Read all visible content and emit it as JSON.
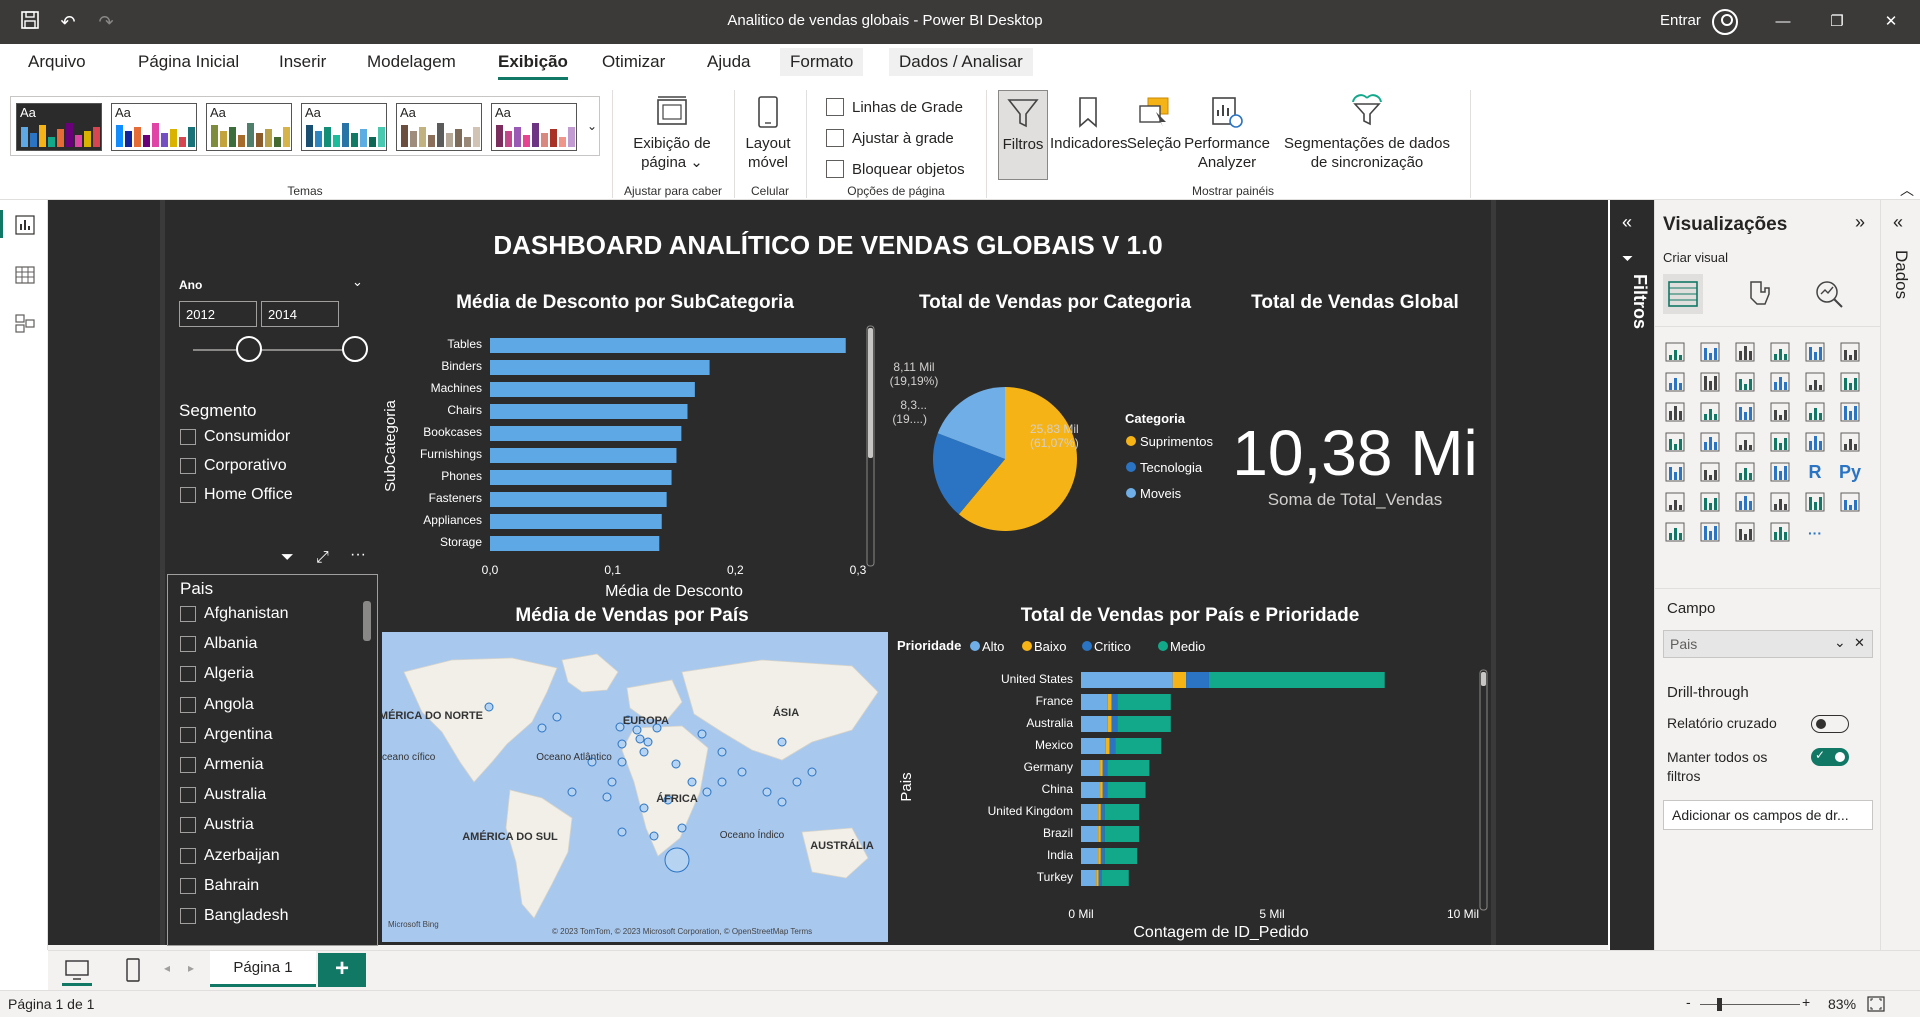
{
  "window": {
    "title": "Analitico de vendas globais - Power BI Desktop",
    "signin": "Entrar"
  },
  "tabs": [
    "Arquivo",
    "Página Inicial",
    "Inserir",
    "Modelagem",
    "Exibição",
    "Otimizar",
    "Ajuda",
    "Formato",
    "Dados / Analisar"
  ],
  "ribbon": {
    "group_temas": "Temas",
    "theme_aa": "Aa",
    "fit_label": "Exibição de página",
    "fit_group": "Ajustar para caber",
    "layout_label": "Layout móvel",
    "layout_group": "Celular",
    "check_grid": "Linhas de Grade",
    "check_snap": "Ajustar à grade",
    "check_lock": "Bloquear objetos",
    "options_group": "Opções de página",
    "btn_filters": "Filtros",
    "btn_bookmarks": "Indicadores",
    "btn_selection": "Seleção",
    "btn_perf": "Performance Analyzer",
    "btn_sync": "Segmentações de dados de sincronização",
    "panes_group": "Mostrar painéis"
  },
  "report": {
    "title": "DASHBOARD ANALÍTICO DE VENDAS GLOBAIS V 1.0",
    "year_slicer": {
      "label": "Ano",
      "from": "2012",
      "to": "2014"
    },
    "segment_slicer": {
      "label": "Segmento",
      "items": [
        "Consumidor",
        "Corporativo",
        "Home Office"
      ]
    },
    "country_slicer": {
      "label": "Pais",
      "items": [
        "Afghanistan",
        "Albania",
        "Algeria",
        "Angola",
        "Argentina",
        "Armenia",
        "Australia",
        "Austria",
        "Azerbaijan",
        "Bahrain",
        "Bangladesh"
      ]
    },
    "map": {
      "title": "Média de Vendas por País",
      "labels": [
        "AMÉRICA DO NORTE",
        "EUROPA",
        "ÁSIA",
        "Oceano Atlântico",
        "ÁFRICA",
        "AMÉRICA DO SUL",
        "Oceano Índico",
        "AUSTRÁLIA",
        "ceano cífico"
      ],
      "attribution": "© 2023 TomTom, © 2023 Microsoft Corporation, © OpenStreetMap  Terms",
      "brand": "Microsoft Bing"
    },
    "kpi": {
      "title": "Total de Vendas Global",
      "value": "10,38 Mi",
      "caption": "Soma de Total_Vendas"
    }
  },
  "chart_data": [
    {
      "type": "bar",
      "title": "Média de Desconto por SubCategoria",
      "xlabel": "Média de Desconto",
      "ylabel": "SubCategoria",
      "categories": [
        "Tables",
        "Binders",
        "Machines",
        "Chairs",
        "Bookcases",
        "Furnishings",
        "Phones",
        "Fasteners",
        "Appliances",
        "Storage"
      ],
      "values": [
        0.29,
        0.179,
        0.167,
        0.161,
        0.156,
        0.152,
        0.148,
        0.144,
        0.14,
        0.138
      ],
      "xticks": [
        "0,0",
        "0,1",
        "0,2",
        "0,3"
      ],
      "xlim": [
        0,
        0.3
      ],
      "color": "#5ea8e6"
    },
    {
      "type": "pie",
      "title": "Total de Vendas por Categoria",
      "legend_title": "Categoria",
      "slices": [
        {
          "name": "Suprimentos",
          "value": 61.07,
          "label": "25,83 Mil (61,07%)",
          "color": "#f5b316"
        },
        {
          "name": "Tecnologia",
          "value": 19.74,
          "label": "8,3... (19....)",
          "color": "#2a74c3"
        },
        {
          "name": "Moveis",
          "value": 19.19,
          "label": "8,11 Mil (19,19%)",
          "color": "#6faee6"
        }
      ]
    },
    {
      "type": "bar",
      "title": "Total de Vendas por País e Prioridade",
      "legend_title": "Prioridade",
      "xlabel": "Contagem de ID_Pedido",
      "ylabel": "Pais",
      "xticks": [
        "0 Mil",
        "5 Mil",
        "10 Mil"
      ],
      "xlim": [
        0,
        10
      ],
      "categories": [
        "United States",
        "France",
        "Australia",
        "Mexico",
        "Germany",
        "China",
        "United Kingdom",
        "Brazil",
        "India",
        "Turkey"
      ],
      "series": [
        {
          "name": "Alto",
          "color": "#6faee6",
          "values": [
            2.4,
            0.7,
            0.7,
            0.65,
            0.5,
            0.5,
            0.45,
            0.45,
            0.45,
            0.4
          ]
        },
        {
          "name": "Baixo",
          "color": "#f5b316",
          "values": [
            0.35,
            0.1,
            0.1,
            0.1,
            0.07,
            0.07,
            0.07,
            0.07,
            0.07,
            0.06
          ]
        },
        {
          "name": "Critico",
          "color": "#2a74c3",
          "values": [
            0.6,
            0.15,
            0.15,
            0.15,
            0.12,
            0.12,
            0.1,
            0.1,
            0.1,
            0.09
          ]
        },
        {
          "name": "Medio",
          "color": "#12a98b",
          "values": [
            4.6,
            1.4,
            1.4,
            1.2,
            1.1,
            1.0,
            0.9,
            0.9,
            0.85,
            0.7
          ]
        }
      ]
    }
  ],
  "viz_pane": {
    "title": "Visualizações",
    "build": "Criar visual",
    "field_section": "Campo",
    "field_value": "Pais",
    "drill": "Drill-through",
    "cross": "Relatório cruzado",
    "keep": "Manter todos os filtros",
    "add": "Adicionar os campos de dr...",
    "data_tab": "Dados",
    "filters_tab": "Filtros",
    "r": "R",
    "py": "Py",
    "more": "···"
  },
  "pages": {
    "tab": "Página 1",
    "add": "+"
  },
  "status": {
    "page": "Página 1 de 1",
    "zoom": "83%",
    "minus": "-",
    "plus": "+"
  }
}
